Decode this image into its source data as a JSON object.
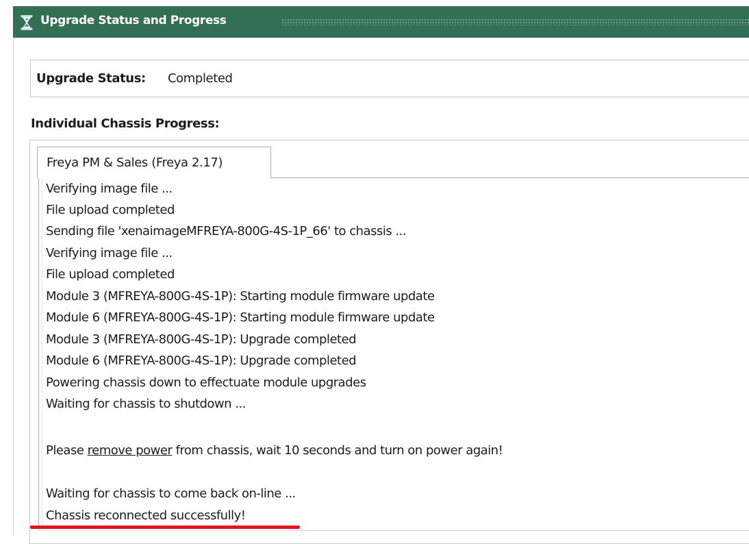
{
  "panel": {
    "title": "Upgrade Status and Progress",
    "title_icon": "hourglass-icon",
    "colors": {
      "titlebar_bg": "#336f55",
      "title_text": "#ffffff",
      "highlight_underline": "#e3151c"
    }
  },
  "status": {
    "label": "Upgrade Status:",
    "value": "Completed"
  },
  "progress": {
    "heading": "Individual Chassis Progress:",
    "tabs": [
      {
        "label": "Freya PM & Sales (Freya 2.17)",
        "selected": true
      }
    ],
    "log_lines": [
      {
        "text": "Verifying image file ..."
      },
      {
        "text": "File upload completed"
      },
      {
        "text": "Sending file 'xenaimageMFREYA-800G-4S-1P_66' to chassis ..."
      },
      {
        "text": "Verifying image file ..."
      },
      {
        "text": "File upload completed"
      },
      {
        "text": "Module 3 (MFREYA-800G-4S-1P): Starting module firmware update"
      },
      {
        "text": "Module 6 (MFREYA-800G-4S-1P): Starting module firmware update"
      },
      {
        "text": "Module 3 (MFREYA-800G-4S-1P): Upgrade completed"
      },
      {
        "text": "Module 6 (MFREYA-800G-4S-1P): Upgrade completed"
      },
      {
        "text": "Powering chassis down to effectuate module upgrades"
      },
      {
        "text": "Waiting for chassis to shutdown ..."
      },
      {
        "text": ""
      },
      {
        "prefix": "Please ",
        "link": "remove power",
        "suffix": " from chassis, wait 10 seconds and turn on power again!"
      },
      {
        "text": ""
      },
      {
        "text": "Waiting for chassis to come back on-line ..."
      },
      {
        "text": "Chassis reconnected successfully!"
      }
    ]
  }
}
